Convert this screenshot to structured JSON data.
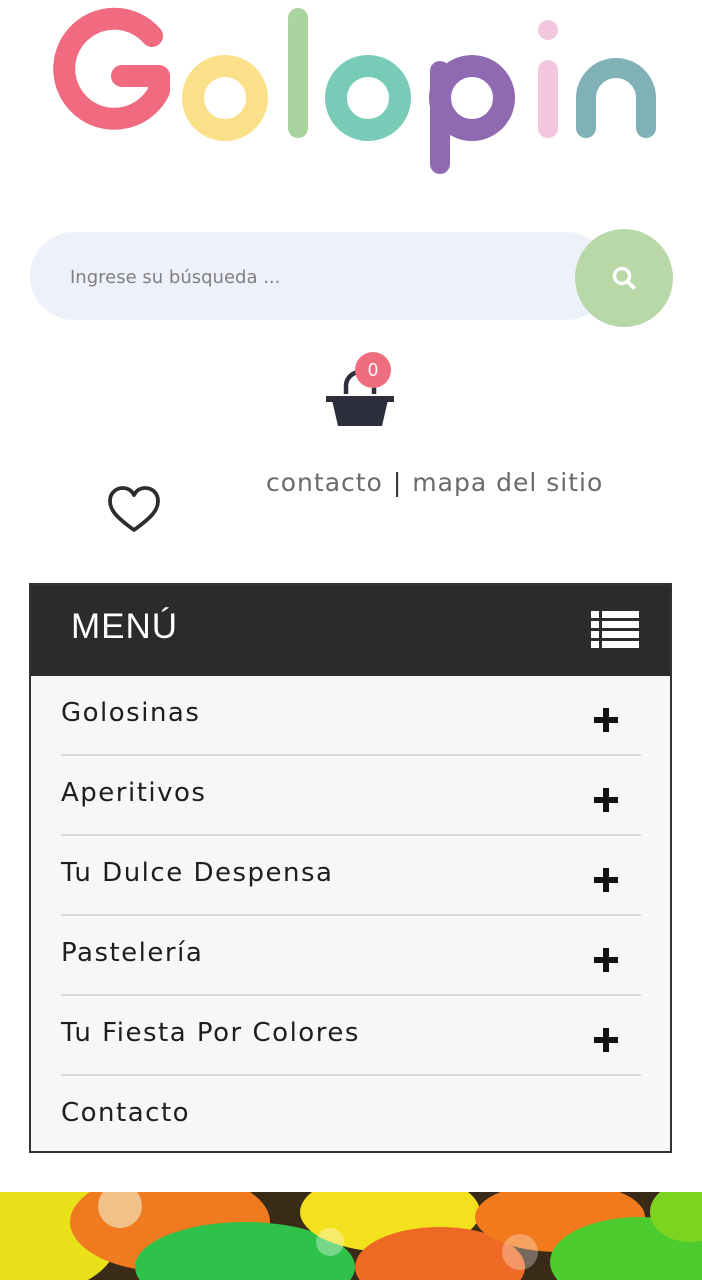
{
  "logo": {
    "letters": [
      "G",
      "o",
      "l",
      "o",
      "p",
      "i",
      "n"
    ],
    "colors": [
      "#f06b80",
      "#fbe08a",
      "#a9d49f",
      "#78cbb6",
      "#8f6ab0",
      "#f2c6dc",
      "#7fb1b6"
    ]
  },
  "search": {
    "placeholder": "Ingrese su búsqueda ...",
    "button_icon": "search-icon"
  },
  "cart": {
    "icon": "shopping-bag-icon",
    "count": "0"
  },
  "wishlist": {
    "icon": "heart-icon"
  },
  "top_links": {
    "contact": "contacto",
    "separator": "|",
    "sitemap": "mapa del sitio"
  },
  "menu": {
    "title": "MENÚ",
    "toggle_icon": "list-icon",
    "items": [
      {
        "label": "Golosinas",
        "expandable": true
      },
      {
        "label": "Aperitivos",
        "expandable": true
      },
      {
        "label": "Tu Dulce Despensa",
        "expandable": true
      },
      {
        "label": "Pastelería",
        "expandable": true
      },
      {
        "label": "Tu Fiesta Por Colores",
        "expandable": true
      },
      {
        "label": "Contacto",
        "expandable": false
      }
    ]
  },
  "colors": {
    "search_bg": "#eef0fa",
    "search_button": "#b8d8a8",
    "badge": "#ee6d7e",
    "menu_header": "#2b2b2b",
    "menu_bg": "#f8f6f7"
  }
}
